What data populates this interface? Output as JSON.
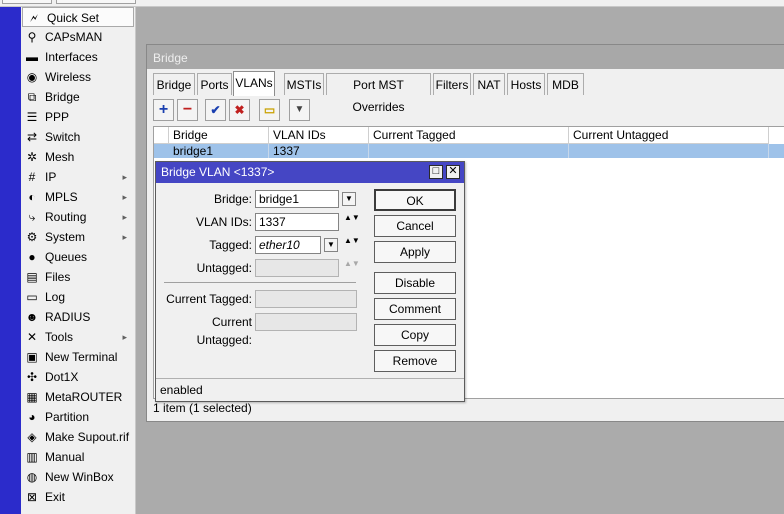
{
  "colors": {
    "side_strip": "#2b2bcb",
    "dialog_title_bg": "#4546c4",
    "selected_row": "#9ec2e9",
    "inactive_title_bg": "#a8a8a8"
  },
  "sidebar": {
    "items": [
      {
        "label": "Quick Set",
        "icon": "quick-set-icon",
        "glyph": "🗲",
        "submenu": false,
        "active": true
      },
      {
        "label": "CAPsMAN",
        "icon": "capsman-icon",
        "glyph": "⚲",
        "submenu": false
      },
      {
        "label": "Interfaces",
        "icon": "interfaces-icon",
        "glyph": "▬",
        "submenu": false
      },
      {
        "label": "Wireless",
        "icon": "wireless-icon",
        "glyph": "◉",
        "submenu": false
      },
      {
        "label": "Bridge",
        "icon": "bridge-icon",
        "glyph": "⧉",
        "submenu": false
      },
      {
        "label": "PPP",
        "icon": "ppp-icon",
        "glyph": "☰",
        "submenu": false
      },
      {
        "label": "Switch",
        "icon": "switch-icon",
        "glyph": "⇄",
        "submenu": false
      },
      {
        "label": "Mesh",
        "icon": "mesh-icon",
        "glyph": "✲",
        "submenu": false
      },
      {
        "label": "IP",
        "icon": "ip-icon",
        "glyph": "#",
        "submenu": true
      },
      {
        "label": "MPLS",
        "icon": "mpls-icon",
        "glyph": "◐",
        "submenu": true
      },
      {
        "label": "Routing",
        "icon": "routing-icon",
        "glyph": "⤷",
        "submenu": true
      },
      {
        "label": "System",
        "icon": "system-icon",
        "glyph": "⚙",
        "submenu": true
      },
      {
        "label": "Queues",
        "icon": "queues-icon",
        "glyph": "●",
        "submenu": false
      },
      {
        "label": "Files",
        "icon": "files-icon",
        "glyph": "▤",
        "submenu": false
      },
      {
        "label": "Log",
        "icon": "log-icon",
        "glyph": "▭",
        "submenu": false
      },
      {
        "label": "RADIUS",
        "icon": "radius-icon",
        "glyph": "☻",
        "submenu": false
      },
      {
        "label": "Tools",
        "icon": "tools-icon",
        "glyph": "✕",
        "submenu": true
      },
      {
        "label": "New Terminal",
        "icon": "terminal-icon",
        "glyph": "▣",
        "submenu": false
      },
      {
        "label": "Dot1X",
        "icon": "dot1x-icon",
        "glyph": "✣",
        "submenu": false
      },
      {
        "label": "MetaROUTER",
        "icon": "metarouter-icon",
        "glyph": "▦",
        "submenu": false
      },
      {
        "label": "Partition",
        "icon": "partition-icon",
        "glyph": "◕",
        "submenu": false
      },
      {
        "label": "Make Supout.rif",
        "icon": "supout-icon",
        "glyph": "◈",
        "submenu": false
      },
      {
        "label": "Manual",
        "icon": "manual-icon",
        "glyph": "▥",
        "submenu": false
      },
      {
        "label": "New WinBox",
        "icon": "winbox-icon",
        "glyph": "◍",
        "submenu": false
      },
      {
        "label": "Exit",
        "icon": "exit-icon",
        "glyph": "⊠",
        "submenu": false
      }
    ]
  },
  "bridge_window": {
    "title": "Bridge",
    "tabs": [
      "Bridge",
      "Ports",
      "VLANs",
      "MSTIs",
      "Port MST Overrides",
      "Filters",
      "NAT",
      "Hosts",
      "MDB"
    ],
    "active_tab": "VLANs",
    "toolbar": {
      "add": "+",
      "remove": "−",
      "enable": "✔",
      "disable": "✖",
      "comment": "▭",
      "filter": "▼"
    },
    "columns": [
      "Bridge",
      "VLAN IDs",
      "Current Tagged",
      "Current Untagged"
    ],
    "rows": [
      {
        "bridge": "bridge1",
        "vlan_ids": "1337",
        "current_tagged": "",
        "current_untagged": ""
      }
    ],
    "status": "1 item (1 selected)"
  },
  "vlan_dialog": {
    "title": "Bridge VLAN <1337>",
    "minimize_glyph": "□",
    "close_glyph": "✕",
    "dropdown_glyph": "▼",
    "spin_glyph": "▲▼",
    "fields": {
      "bridge_label": "Bridge:",
      "bridge_value": "bridge1",
      "vlan_ids_label": "VLAN IDs:",
      "vlan_ids_value": "1337",
      "tagged_label": "Tagged:",
      "tagged_value": "ether10",
      "untagged_label": "Untagged:",
      "untagged_value": "",
      "current_tagged_label": "Current Tagged:",
      "current_tagged_value": "",
      "current_untagged_label": "Current Untagged:",
      "current_untagged_value": ""
    },
    "buttons": {
      "ok": "OK",
      "cancel": "Cancel",
      "apply": "Apply",
      "disable": "Disable",
      "comment": "Comment",
      "copy": "Copy",
      "remove": "Remove"
    },
    "status": "enabled"
  }
}
